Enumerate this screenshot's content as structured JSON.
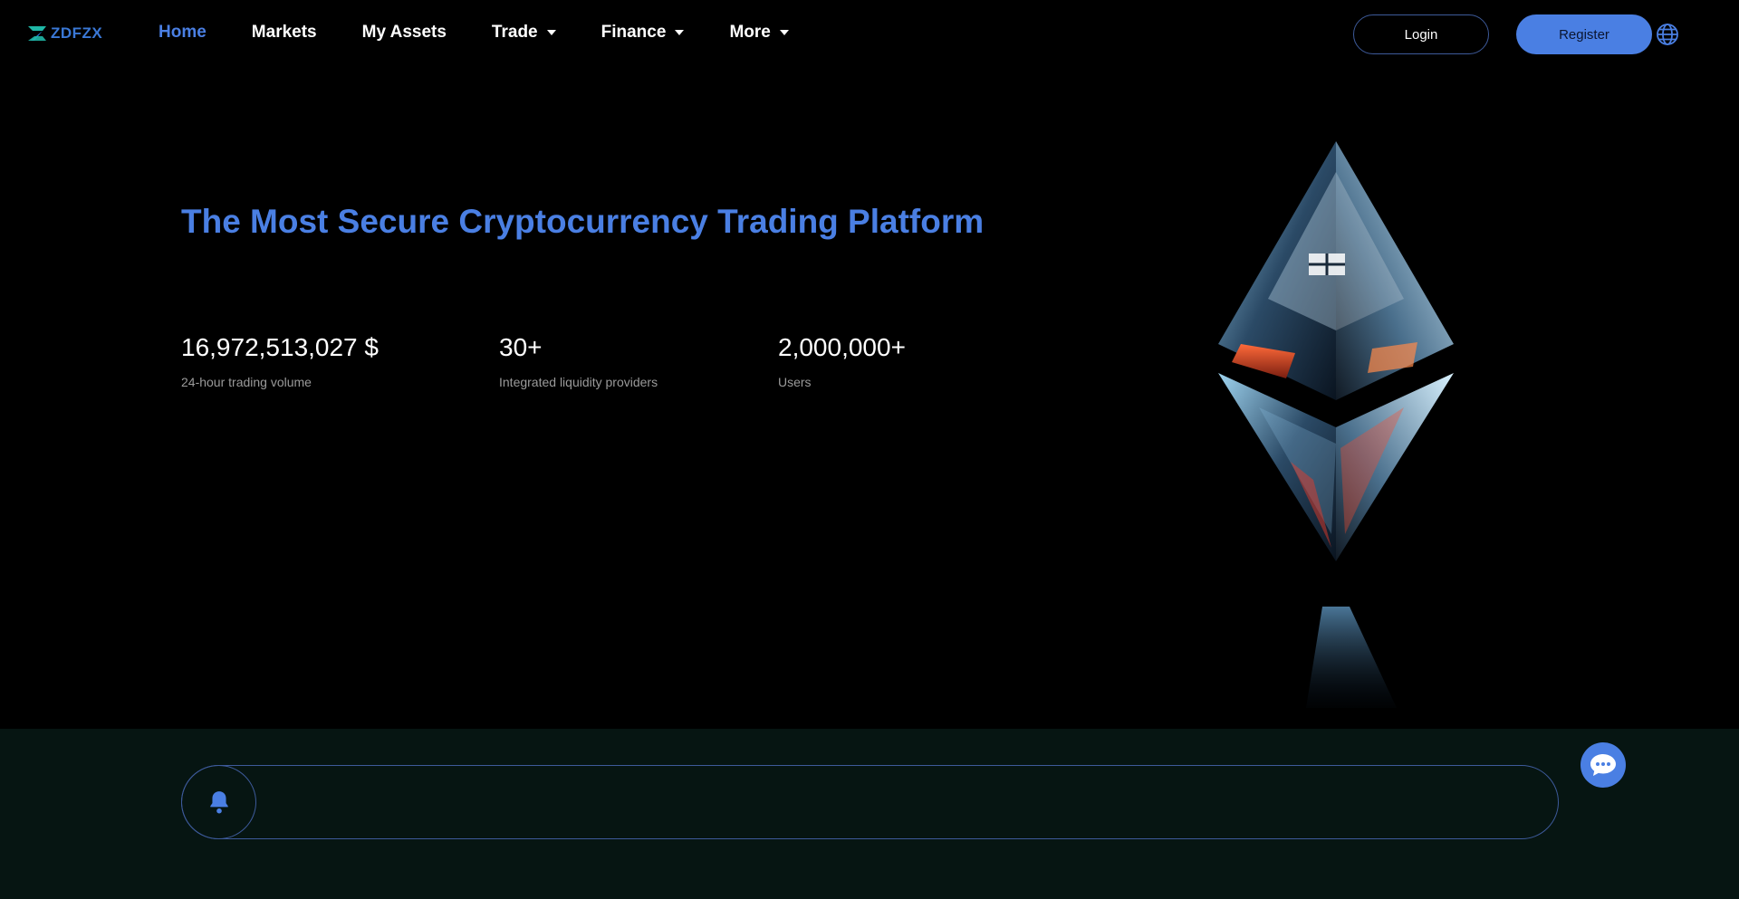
{
  "brand": {
    "name": "ZDFZX",
    "color": "#3a78d6"
  },
  "nav": {
    "items": [
      {
        "label": "Home",
        "active": true,
        "dropdown": false
      },
      {
        "label": "Markets",
        "active": false,
        "dropdown": false
      },
      {
        "label": "My Assets",
        "active": false,
        "dropdown": false
      },
      {
        "label": "Trade",
        "active": false,
        "dropdown": true
      },
      {
        "label": "Finance",
        "active": false,
        "dropdown": true
      },
      {
        "label": "More",
        "active": false,
        "dropdown": true
      }
    ]
  },
  "auth": {
    "login_label": "Login",
    "register_label": "Register"
  },
  "icons": {
    "language": "globe-icon",
    "notice": "bell-icon",
    "chat": "chat-icon"
  },
  "hero": {
    "title": "The Most Secure Cryptocurrency Trading Platform",
    "stats": [
      {
        "value": "16,972,513,027 $",
        "label": "24-hour trading volume"
      },
      {
        "value": "30+",
        "label": "Integrated liquidity providers"
      },
      {
        "value": "2,000,000+",
        "label": "Users"
      }
    ]
  },
  "notice": {
    "text": ""
  },
  "colors": {
    "accent": "#4a7fe3",
    "background": "#000000",
    "band": "#061512",
    "border": "#3d5a9a"
  }
}
